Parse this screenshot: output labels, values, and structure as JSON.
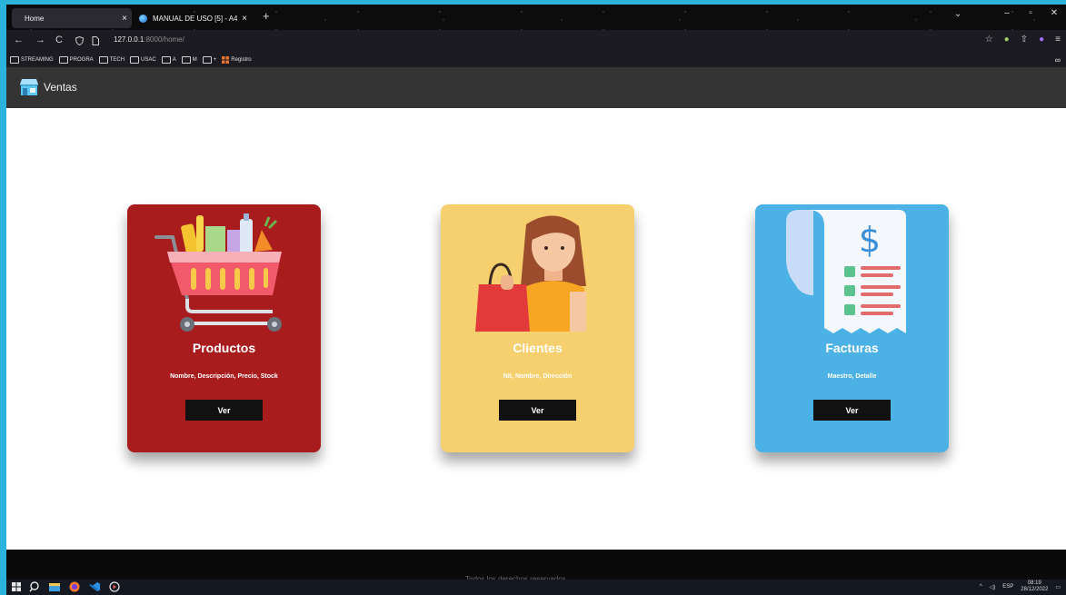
{
  "browser": {
    "active_tab": {
      "title": "Home",
      "close": "×"
    },
    "inactive_tab": {
      "title": "MANUAL DE USO [5] - A4",
      "close": "×"
    },
    "new_tab": "+",
    "tab_list": "⌄",
    "window_controls": {
      "minimize": "–",
      "maximize": "▫",
      "close": "✕"
    },
    "url_host": "127.0.0.1",
    "url_rest": ":8000/home/",
    "nav": {
      "back": "←",
      "forward": "→",
      "reload": "C"
    }
  },
  "bookmarks": [
    {
      "label": "STREAMING",
      "icon": "folder-icon"
    },
    {
      "label": "PROGRA",
      "icon": "folder-icon"
    },
    {
      "label": "TECH",
      "icon": "folder-icon"
    },
    {
      "label": "USAC",
      "icon": "folder-icon"
    },
    {
      "label": "A",
      "icon": "folder-icon"
    },
    {
      "label": "M",
      "icon": "folder-icon"
    },
    {
      "label": "+",
      "icon": "folder-icon"
    },
    {
      "label": "Registro",
      "icon": "spreadsheet-icon"
    }
  ],
  "bookmarks_overflow": "∞",
  "site": {
    "brand": "Ventas"
  },
  "cards": {
    "products": {
      "title": "Productos",
      "desc": "Nombre, Descripción, Precio, Stock",
      "button": "Ver"
    },
    "clients": {
      "title": "Clientes",
      "desc": "Nit, Nombre, Dirección",
      "button": "Ver"
    },
    "invoices": {
      "title": "Facturas",
      "desc": "Maestro, Detalle",
      "button": "Ver"
    }
  },
  "footer": {
    "text": "Todos los derechos reservados"
  },
  "taskbar": {
    "lang": "ESP",
    "time": "08:19",
    "date": "28/12/2022"
  },
  "colors": {
    "products": "#a81c1e",
    "clients": "#f6cf6e",
    "invoices": "#4cb1e5",
    "header": "#343434"
  }
}
